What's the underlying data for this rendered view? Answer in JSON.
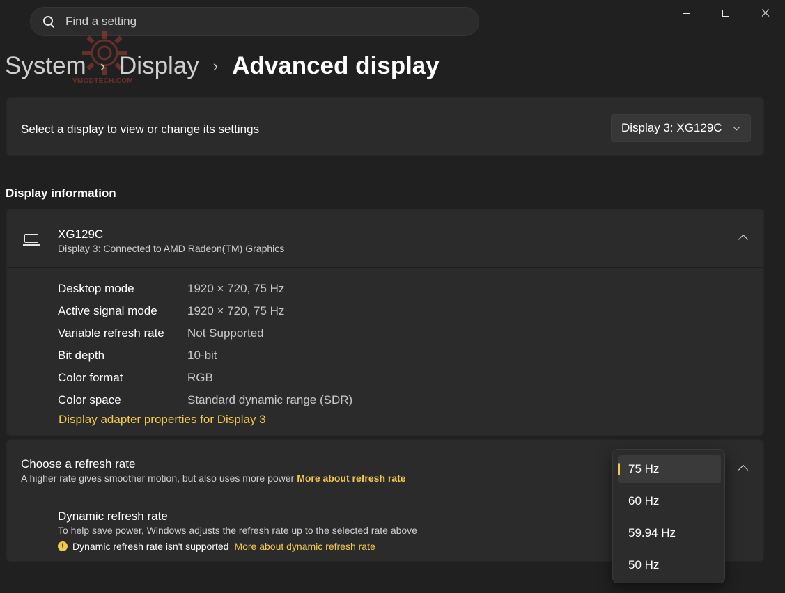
{
  "search": {
    "placeholder": "Find a setting"
  },
  "breadcrumb": {
    "items": [
      "System",
      "Display"
    ],
    "current": "Advanced display"
  },
  "watermark": {
    "text": "VMODTECH.COM"
  },
  "display_select": {
    "label": "Select a display to view or change its settings",
    "selected": "Display 3: XG129C"
  },
  "display_info": {
    "heading": "Display information",
    "name": "XG129C",
    "subtitle": "Display 3: Connected to AMD Radeon(TM) Graphics",
    "rows": [
      {
        "key": "Desktop mode",
        "value": "1920 × 720, 75 Hz"
      },
      {
        "key": "Active signal mode",
        "value": "1920 × 720, 75 Hz"
      },
      {
        "key": "Variable refresh rate",
        "value": "Not Supported"
      },
      {
        "key": "Bit depth",
        "value": "10-bit"
      },
      {
        "key": "Color format",
        "value": "RGB"
      },
      {
        "key": "Color space",
        "value": "Standard dynamic range (SDR)"
      }
    ],
    "adapter_link": "Display adapter properties for Display 3"
  },
  "refresh": {
    "title": "Choose a refresh rate",
    "subtitle": "A higher rate gives smoother motion, but also uses more power",
    "link": "More about refresh rate",
    "options": [
      "75 Hz",
      "60 Hz",
      "59.94 Hz",
      "50 Hz"
    ],
    "selected": "75 Hz"
  },
  "dynamic": {
    "title": "Dynamic refresh rate",
    "subtitle": "To help save power, Windows adjusts the refresh rate up to the selected rate above",
    "warning": "Dynamic refresh rate isn't supported",
    "link": "More about dynamic refresh rate"
  },
  "icons": {
    "search": "search-icon",
    "minimize": "minimize-icon",
    "maximize": "maximize-icon",
    "close": "close-icon",
    "laptop": "laptop-icon",
    "warning": "warning-icon",
    "chevron_up": "chevron-up-icon",
    "chevron_down": "chevron-down-icon",
    "chevron_right": "chevron-right-icon"
  },
  "colors": {
    "background": "#202020",
    "card": "#2b2b2b",
    "accent": "#f2c94c"
  }
}
